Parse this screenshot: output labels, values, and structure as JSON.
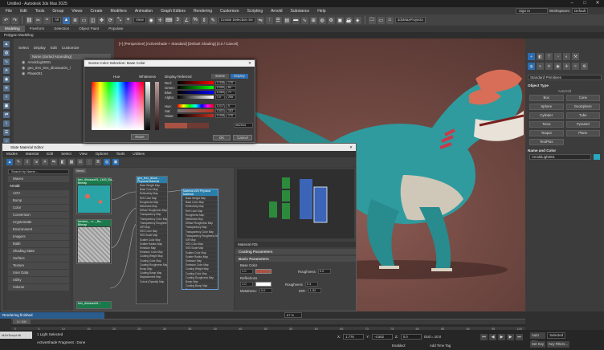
{
  "app": {
    "title": "Untitled - Autodesk 3ds Max 2025",
    "menu": [
      "File",
      "Edit",
      "Tools",
      "Group",
      "Views",
      "Create",
      "Modifiers",
      "Animation",
      "Graph Editors",
      "Rendering",
      "Customize",
      "Scripting",
      "Arnold",
      "Substance",
      "Help"
    ],
    "sign_in": "Sign In",
    "workspaces_label": "Workspaces:",
    "workspace": "Default"
  },
  "toolbar": {
    "selection_filter": "All",
    "view_dropdown": "View",
    "create_selection_set": "Create Selection Se",
    "project": "3dsMaxProjects"
  },
  "ribbon": {
    "tabs": [
      "Modeling",
      "Freeform",
      "Selection",
      "Object Paint",
      "Populate"
    ],
    "active_tab": "Modeling",
    "subtitle": "Polygon Modeling"
  },
  "scene_explorer": {
    "menu": [
      "Select",
      "Display",
      "Edit",
      "Customize"
    ],
    "header": "Name (Sorted Ascending)",
    "items": [
      "ArnoldLight001",
      "geo_trex_trex_dinosaur01_l",
      "Plane001"
    ]
  },
  "viewport": {
    "label": "[+] [Perspective] [ActiveShade + Standard] [Default Shading] [3.0 / Cancel]"
  },
  "color_dialog": {
    "title": "Scene Color Selection: Base Color",
    "hue_label": "Hue",
    "whiteness_label": "Whiteness",
    "display_label": "Display Referred",
    "tabs": [
      "Scene",
      "Display"
    ],
    "sliders": [
      {
        "label": "Red:",
        "value": "0.308",
        "display": "178"
      },
      {
        "label": "Green:",
        "value": "0.090",
        "display": "84"
      },
      {
        "label": "Blue:",
        "value": "0.062",
        "display": "71"
      },
      {
        "label": "Alpha:",
        "value": "1.0",
        "display": "255"
      },
      {
        "label": "Hue:",
        "value": "0.017",
        "display": "5"
      },
      {
        "label": "Sat:",
        "value": "0.601",
        "display": "153"
      },
      {
        "label": "Value:",
        "value": "0.308",
        "display": "178"
      }
    ],
    "hex": "#B2544",
    "reset": "Reset",
    "ok": "OK",
    "cancel": "Cancel",
    "colors": {
      "current": "#a85244",
      "previous": "#6e3a34"
    }
  },
  "slate": {
    "title": "Slate Material Editor",
    "menu": [
      "Modes",
      "Material",
      "Edit",
      "Select",
      "View",
      "Options",
      "Tools",
      "Utilities"
    ],
    "search": "Search by Name ...",
    "view_tab": "View1",
    "browser_items": [
      {
        "label": "Waves",
        "group": false
      },
      {
        "label": "Arnold",
        "group": true
      },
      {
        "label": "AOV",
        "group": false
      },
      {
        "label": "Bump",
        "group": false
      },
      {
        "label": "Color",
        "group": false
      },
      {
        "label": "Conversion",
        "group": false
      },
      {
        "label": "Cryptomatte",
        "group": false
      },
      {
        "label": "Environment",
        "group": false
      },
      {
        "label": "Imagers",
        "group": false
      },
      {
        "label": "Math",
        "group": false
      },
      {
        "label": "Shading State",
        "group": false
      },
      {
        "label": "Surface",
        "group": false
      },
      {
        "label": "Texture",
        "group": false
      },
      {
        "label": "User Data",
        "group": false
      },
      {
        "label": "Utility",
        "group": false
      },
      {
        "label": "Volume",
        "group": false
      }
    ],
    "nodes": {
      "bitmap1": "trex_dinosaur01_1k00_Ba... Bitmap",
      "bitmap2": "trextest_...n..._Ba... Bitmap",
      "physmat": "geo_trex_dinos... Physical Material",
      "material": "Material #25 Physical Material",
      "bitmap3": "trex_dinosaur01..."
    },
    "node_params": [
      "Base Weight Map",
      "Base Color Map",
      "Reflectivity Map",
      "Refl Color Map",
      "Roughness Map",
      "Metalness Map",
      "Diffuse Roughness Map",
      "Transparency Map",
      "Transparency Color Map",
      "Transparency Roughness Map",
      "IOR Map",
      "SSS Color Map",
      "SSS Scale Map",
      "Scatter Color Map",
      "Scatter Radius Map",
      "Emission Map",
      "Emission Color Map",
      "Coating Weight Map",
      "Coating Color Map",
      "Coating Roughness Map",
      "Bump Map",
      "Coating Bump Map",
      "Displacement Map",
      "Cutout (Opacity) Map"
    ],
    "params": {
      "material_name": "Material #25",
      "coating_params": "Coating Parameters",
      "basic_params": "Basic Parameters",
      "base_color": "Base Color",
      "base_weight": "1.0",
      "roughness_label": "Roughness",
      "roughness_value": "0.0",
      "reflections": "Reflections",
      "refl_weight": "1.0",
      "refl_roughness_label": "Roughness",
      "refl_roughness_value": "0.4",
      "metalness_label": "Metalness:",
      "metalness_value": "0.0",
      "ior_label": "IOR:",
      "ior_value": "1.52"
    }
  },
  "right_panel": {
    "dropdown": "Standard Primitives",
    "object_type": "Object Type",
    "autogrid": "AutoGrid",
    "buttons": [
      "Box",
      "Cone",
      "Sphere",
      "GeoSphere",
      "Cylinder",
      "Tube",
      "Torus",
      "Pyramid",
      "Teapot",
      "Plane",
      "TextPlus"
    ],
    "name_color": "Name and Color",
    "name_value": "ArnoldLight001",
    "swatch": "#2aa8c2"
  },
  "status": {
    "rendering": "Rendering finished",
    "selected": "1 Light Selected",
    "activeshade": "ActiveShade Fragment : Done",
    "script": "MAXScript Mi",
    "timeline_start": "0 / 100",
    "zoom": "67 %",
    "x": "1.776",
    "y": "-4.562",
    "z": "0.0",
    "grid": "Grid = 10.0",
    "enabled": "Enabled:",
    "add_time_tag": "Add Time Tag",
    "auto_key": "Auto Key",
    "selected_dd": "Selected",
    "set_key": "Set Key",
    "key_filters": "Key Filters..."
  }
}
